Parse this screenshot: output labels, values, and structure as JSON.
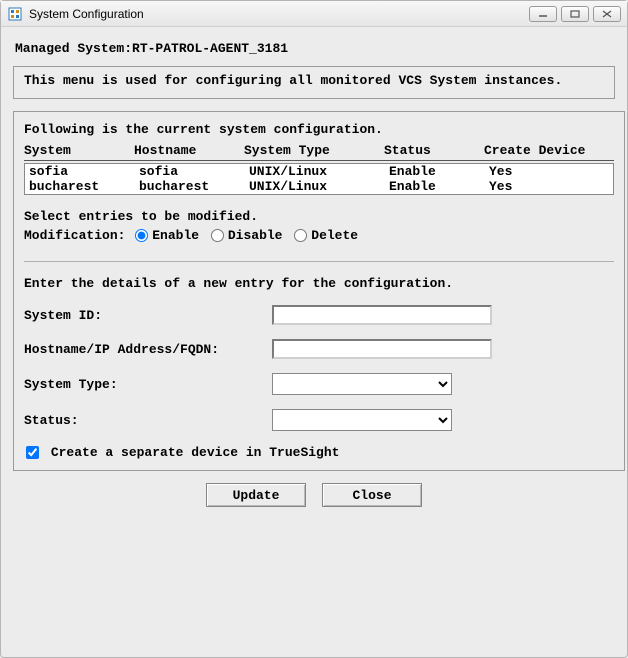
{
  "window": {
    "title": "System Configuration"
  },
  "header": {
    "managed_label": "Managed System:",
    "managed_value": "RT-PATROL-AGENT_3181"
  },
  "info_panel": {
    "text": "This menu is used for configuring all monitored VCS System instances."
  },
  "config_panel": {
    "intro": "Following is the current system configuration.",
    "columns": {
      "system": "System",
      "hostname": "Hostname",
      "system_type": "System Type",
      "status": "Status",
      "create_device": "Create Device"
    },
    "rows": [
      {
        "system": "sofia",
        "hostname": "sofia",
        "system_type": "UNIX/Linux",
        "status": "Enable",
        "create_device": "Yes"
      },
      {
        "system": "bucharest",
        "hostname": "bucharest",
        "system_type": "UNIX/Linux",
        "status": "Enable",
        "create_device": "Yes"
      }
    ],
    "select_text": "Select entries to be modified.",
    "modification_label": "Modification:",
    "modification_options": {
      "enable": "Enable",
      "disable": "Disable",
      "delete": "Delete"
    },
    "modification_selected": "enable",
    "new_entry_text": "Enter the details of a new entry for the configuration.",
    "form": {
      "system_id_label": "System ID:",
      "system_id_value": "",
      "hostname_label": "Hostname/IP Address/FQDN:",
      "hostname_value": "",
      "system_type_label": "System Type:",
      "system_type_value": "",
      "status_label": "Status:",
      "status_value": ""
    },
    "create_device_label": "Create a separate device in TrueSight",
    "create_device_checked": true
  },
  "buttons": {
    "update": "Update",
    "close": "Close"
  }
}
